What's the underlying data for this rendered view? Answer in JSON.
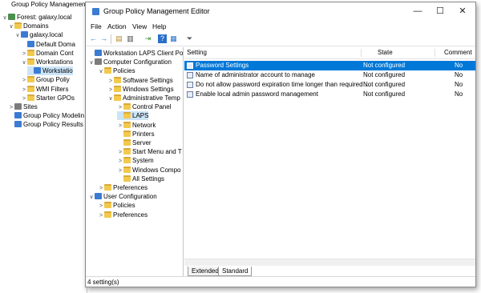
{
  "background_app": {
    "title": "Group Policy Management",
    "tree": [
      {
        "label": "Forest: galaxy.local",
        "depth": 0,
        "expander": "∨",
        "icon": "forest"
      },
      {
        "label": "Domains",
        "depth": 1,
        "expander": "∨",
        "icon": "folder"
      },
      {
        "label": "galaxy.local",
        "depth": 2,
        "expander": "∨",
        "icon": "domain"
      },
      {
        "label": "Default Doma",
        "depth": 3,
        "expander": "",
        "icon": "gpo"
      },
      {
        "label": "Domain Cont",
        "depth": 3,
        "expander": ">",
        "icon": "folder"
      },
      {
        "label": "Workstations",
        "depth": 3,
        "expander": "∨",
        "icon": "folder"
      },
      {
        "label": "Workstatio",
        "depth": 4,
        "expander": "",
        "icon": "gpo",
        "selected": true
      },
      {
        "label": "Group Poliy",
        "depth": 3,
        "expander": ">",
        "icon": "folder"
      },
      {
        "label": "WMI Filters",
        "depth": 3,
        "expander": ">",
        "icon": "folder"
      },
      {
        "label": "Starter GPOs",
        "depth": 3,
        "expander": ">",
        "icon": "folder"
      },
      {
        "label": "Sites",
        "depth": 1,
        "expander": ">",
        "icon": "sites"
      },
      {
        "label": "Group Policy Modelin",
        "depth": 1,
        "expander": "",
        "icon": "gpo"
      },
      {
        "label": "Group Policy Results",
        "depth": 1,
        "expander": "",
        "icon": "gpo"
      }
    ]
  },
  "window": {
    "title": "Group Policy Management Editor",
    "controls": {
      "minimize": "—",
      "maximize": "☐",
      "close": "✕"
    }
  },
  "menu": [
    "File",
    "Action",
    "View",
    "Help"
  ],
  "toolbar": {
    "back": "←",
    "forward": "→",
    "up": "▤",
    "show": "▥",
    "export": "⇥",
    "help": "?",
    "props": "▦",
    "filter": "⏷"
  },
  "left_tree": [
    {
      "label": "Workstation LAPS Client Policy",
      "depth": 0,
      "expander": "",
      "icon": "gpo"
    },
    {
      "label": "Computer Configuration",
      "depth": 0,
      "expander": "∨",
      "icon": "computer"
    },
    {
      "label": "Policies",
      "depth": 1,
      "expander": "∨",
      "icon": "folder"
    },
    {
      "label": "Software Settings",
      "depth": 2,
      "expander": ">",
      "icon": "folder"
    },
    {
      "label": "Windows Settings",
      "depth": 2,
      "expander": ">",
      "icon": "folder"
    },
    {
      "label": "Administrative Temp",
      "depth": 2,
      "expander": "∨",
      "icon": "folder"
    },
    {
      "label": "Control Panel",
      "depth": 3,
      "expander": ">",
      "icon": "folder"
    },
    {
      "label": "LAPS",
      "depth": 3,
      "expander": "",
      "icon": "folder",
      "selected": true
    },
    {
      "label": "Network",
      "depth": 3,
      "expander": ">",
      "icon": "folder"
    },
    {
      "label": "Printers",
      "depth": 3,
      "expander": "",
      "icon": "folder"
    },
    {
      "label": "Server",
      "depth": 3,
      "expander": "",
      "icon": "folder"
    },
    {
      "label": "Start Menu and T",
      "depth": 3,
      "expander": ">",
      "icon": "folder"
    },
    {
      "label": "System",
      "depth": 3,
      "expander": ">",
      "icon": "folder"
    },
    {
      "label": "Windows Compo",
      "depth": 3,
      "expander": ">",
      "icon": "folder"
    },
    {
      "label": "All Settings",
      "depth": 3,
      "expander": "",
      "icon": "folder"
    },
    {
      "label": "Preferences",
      "depth": 1,
      "expander": ">",
      "icon": "folder"
    },
    {
      "label": "User Configuration",
      "depth": 0,
      "expander": "∨",
      "icon": "user"
    },
    {
      "label": "Policies",
      "depth": 1,
      "expander": ">",
      "icon": "folder"
    },
    {
      "label": "Preferences",
      "depth": 1,
      "expander": ">",
      "icon": "folder"
    }
  ],
  "table": {
    "headers": {
      "setting": "Setting",
      "state": "State",
      "comment": "Comment"
    },
    "rows": [
      {
        "setting": "Password Settings",
        "state": "Not configured",
        "comment": "No",
        "selected": true
      },
      {
        "setting": "Name of administrator account to manage",
        "state": "Not configured",
        "comment": "No"
      },
      {
        "setting": "Do not allow password expiration time longer than required ...",
        "state": "Not configured",
        "comment": "No"
      },
      {
        "setting": "Enable local admin password management",
        "state": "Not configured",
        "comment": "No"
      }
    ]
  },
  "tabs": [
    "Extended",
    "Standard"
  ],
  "status": "4 setting(s)"
}
